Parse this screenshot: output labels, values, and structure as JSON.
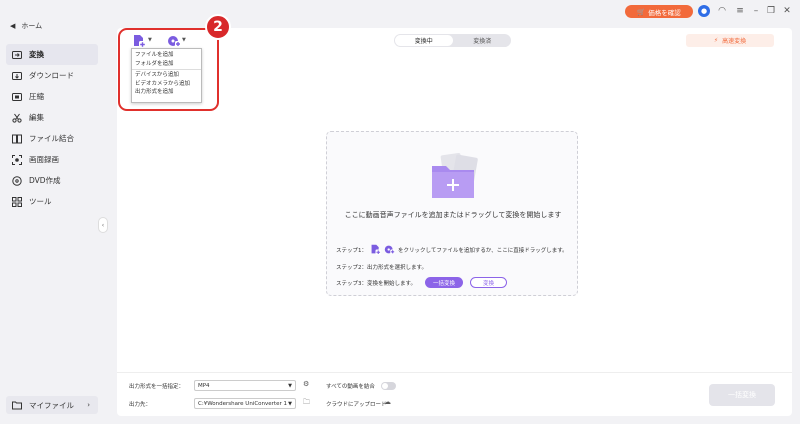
{
  "sidebar": {
    "home_label": "ホーム",
    "items": [
      {
        "label": "変換",
        "icon": "convert-icon",
        "active": true
      },
      {
        "label": "ダウンロード",
        "icon": "download-icon",
        "active": false
      },
      {
        "label": "圧縮",
        "icon": "compress-icon",
        "active": false
      },
      {
        "label": "編集",
        "icon": "scissors-icon",
        "active": false
      },
      {
        "label": "ファイル結合",
        "icon": "merge-icon",
        "active": false
      },
      {
        "label": "画面録画",
        "icon": "screen-record-icon",
        "active": false
      },
      {
        "label": "DVD作成",
        "icon": "dvd-icon",
        "active": false
      },
      {
        "label": "ツール",
        "icon": "tools-icon",
        "active": false
      }
    ],
    "my_files_label": "マイファイル"
  },
  "titlebar": {
    "price_button": "価格を確認"
  },
  "toolbar": {
    "tabs": [
      {
        "label": "変換中",
        "active": true
      },
      {
        "label": "変換済",
        "active": false
      }
    ],
    "fast_convert_label": "高速変換"
  },
  "add_menu": {
    "items": [
      "ファイルを追加",
      "フォルダを追加",
      "デバイスから追加",
      "ビデオカメラから追加",
      "出力形式を追加"
    ]
  },
  "annotation": {
    "badge_number": "2"
  },
  "drop_zone": {
    "title": "ここに動画音声ファイルを追加またはドラッグして変換を開始します",
    "step1_label": "ステップ1：",
    "step1_text": "をクリックしてファイルを追加するか、ここに直接ドラッグします。",
    "step2_text": "ステップ2：出力形式を選択します。",
    "step3_text": "ステップ3：変換を開始します。",
    "batch_convert_button": "一括変換",
    "convert_button": "変換"
  },
  "bottom_bar": {
    "output_format_label": "出力形式を一括指定：",
    "output_format_value": "MP4",
    "merge_label": "すべての動画を結合",
    "output_path_label": "出力先：",
    "output_path_value": "C:¥Wondershare UniConverter 1",
    "cloud_upload_label": "クラウドにアップロード",
    "convert_all_button": "一括変換"
  },
  "colors": {
    "accent_purple": "#8c64e8",
    "price_orange": "#f26a3b",
    "annotation_red": "#d8282a"
  }
}
